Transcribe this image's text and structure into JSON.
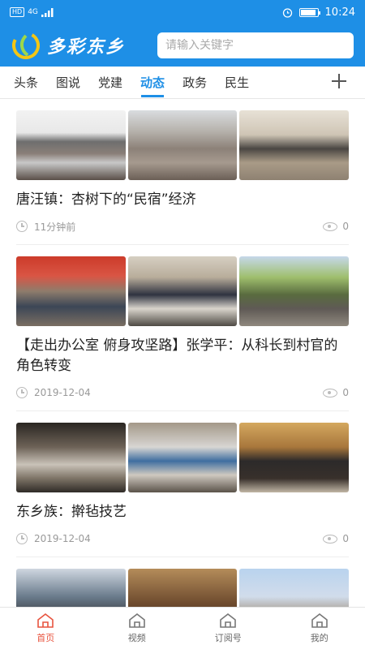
{
  "status_bar": {
    "hd": "HD",
    "network": "4G",
    "time": "10:24",
    "battery_level": 0.9
  },
  "header": {
    "app_title": "多彩东乡",
    "search_placeholder": "请输入关键字"
  },
  "tabs": [
    {
      "label": "头条",
      "active": false
    },
    {
      "label": "图说",
      "active": false
    },
    {
      "label": "党建",
      "active": false
    },
    {
      "label": "动态",
      "active": true
    },
    {
      "label": "政务",
      "active": false
    },
    {
      "label": "民生",
      "active": false
    }
  ],
  "articles": [
    {
      "title": "唐汪镇：杏树下的“民宿”经济",
      "time": "11分钟前",
      "views": "0",
      "image_themes": [
        "mtn",
        "bld1",
        "bld2"
      ]
    },
    {
      "title": "【走出办公室 俯身攻坚路】张学平：从科长到村官的角色转变",
      "time": "2019-12-04",
      "views": "0",
      "image_themes": [
        "mtg1",
        "mtg2",
        "mtg3"
      ]
    },
    {
      "title": "东乡族：擀毡技艺",
      "time": "2019-12-04",
      "views": "0",
      "image_themes": [
        "fab1",
        "fab2",
        "fab3"
      ]
    },
    {
      "title": "",
      "time": "",
      "views": "",
      "image_themes": [
        "m1",
        "m2",
        "m3"
      ]
    }
  ],
  "bottom_nav": [
    {
      "label": "首页",
      "icon": "home-icon",
      "active": true
    },
    {
      "label": "视频",
      "icon": "video-icon",
      "active": false
    },
    {
      "label": "订阅号",
      "icon": "subscribe-icon",
      "active": false
    },
    {
      "label": "我的",
      "icon": "profile-icon",
      "active": false
    }
  ],
  "colors": {
    "brand_blue": "#1e8fe6",
    "active_nav": "#e8543f"
  }
}
